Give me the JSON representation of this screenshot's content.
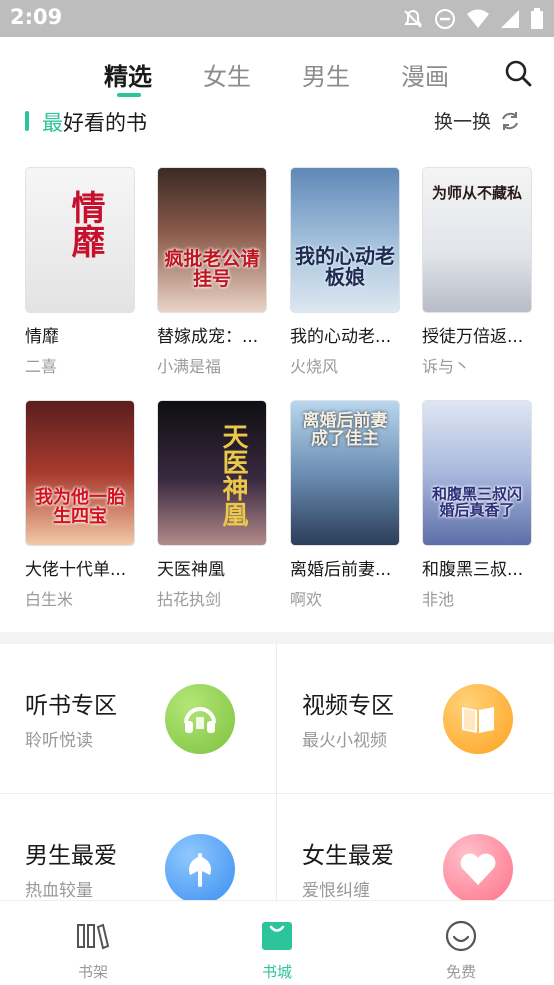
{
  "status_bar": {
    "time": "2:09"
  },
  "tabs": [
    {
      "label": "精选",
      "active": true
    },
    {
      "label": "女生",
      "active": false
    },
    {
      "label": "男生",
      "active": false
    },
    {
      "label": "漫画",
      "active": false
    }
  ],
  "section": {
    "title_first": "最",
    "title_rest": "好看的书",
    "refresh_label": "换一换"
  },
  "books": [
    {
      "title": "情靡",
      "author": "二喜",
      "cover_text": "情靡"
    },
    {
      "title": "替嫁成宠：...",
      "author": "小满是福",
      "cover_text": "疯批老公请挂号"
    },
    {
      "title": "我的心动老...",
      "author": "火烧风",
      "cover_text": "我的心动老板娘"
    },
    {
      "title": "授徒万倍返...",
      "author": "诉与丶",
      "cover_text": "为师从不藏私"
    },
    {
      "title": "大佬十代单...",
      "author": "白生米",
      "cover_text": "我为他一胎生四宝"
    },
    {
      "title": "天医神凰",
      "author": "拈花执剑",
      "cover_text": "天医神凰"
    },
    {
      "title": "离婚后前妻...",
      "author": "啊欢",
      "cover_text": "离婚后前妻成了佳主"
    },
    {
      "title": "和腹黑三叔...",
      "author": "非池",
      "cover_text": "和腹黑三叔闪婚后真香了"
    }
  ],
  "zones": [
    {
      "title": "听书专区",
      "subtitle": "聆听悦读",
      "icon": "headphones-icon",
      "color": "#8fd14f"
    },
    {
      "title": "视频专区",
      "subtitle": "最火小视频",
      "icon": "open-book-icon",
      "color": "#ffb43a"
    },
    {
      "title": "男生最爱",
      "subtitle": "热血较量",
      "icon": "axe-icon",
      "color": "#4aa3f5"
    },
    {
      "title": "女生最爱",
      "subtitle": "爱恨纠缠",
      "icon": "heart-icon",
      "color": "#ff8a9d"
    }
  ],
  "bottom_nav": [
    {
      "label": "书架",
      "icon": "bookshelf-icon",
      "active": false
    },
    {
      "label": "书城",
      "icon": "bookstore-icon",
      "active": true
    },
    {
      "label": "免费",
      "icon": "smile-icon",
      "active": false
    }
  ],
  "colors": {
    "accent": "#2cc49a",
    "statusbar": "#bdbdbd"
  }
}
